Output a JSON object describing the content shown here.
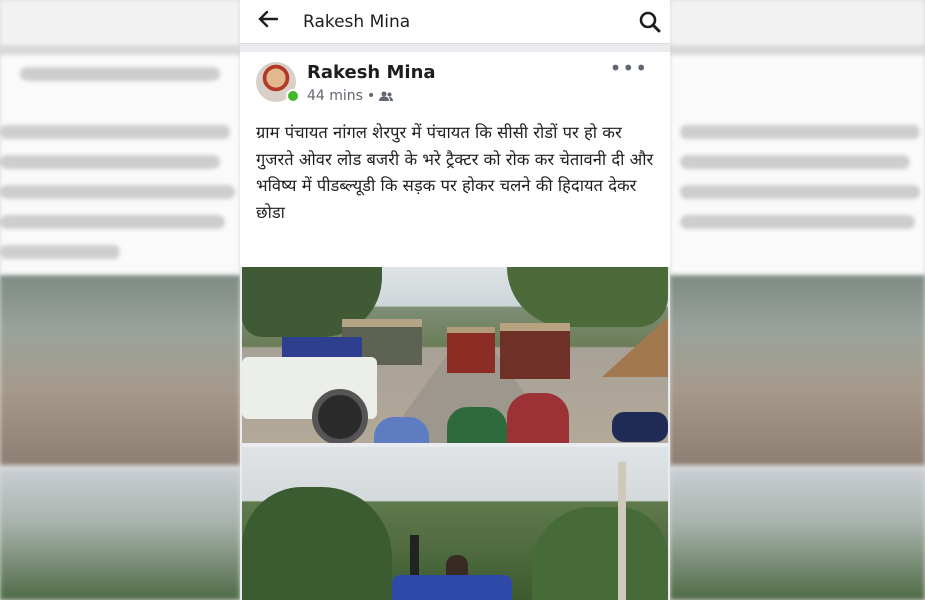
{
  "topbar": {
    "title": "Rakesh Mina"
  },
  "post": {
    "author": "Rakesh Mina",
    "time": "44 mins",
    "separator": "•",
    "text": "ग्राम पंचायत नांगल शेरपुर में पंचायत कि सीसी रोडों पर हो कर गुजरते ओवर लोड बजरी के भरे ट्रैक्टर को रोक कर चेतावनी दी और भविष्य में पीडब्ल्यूडी कि सड़क पर होकर चलने की हिदायत देकर छोडा"
  },
  "icons": {
    "back": "arrow-left-icon",
    "search": "search-icon",
    "more": "more-options-icon",
    "audience": "friends-icon"
  },
  "colors": {
    "online": "#42b72a",
    "text": "#1c1e21",
    "meta": "#616770"
  }
}
